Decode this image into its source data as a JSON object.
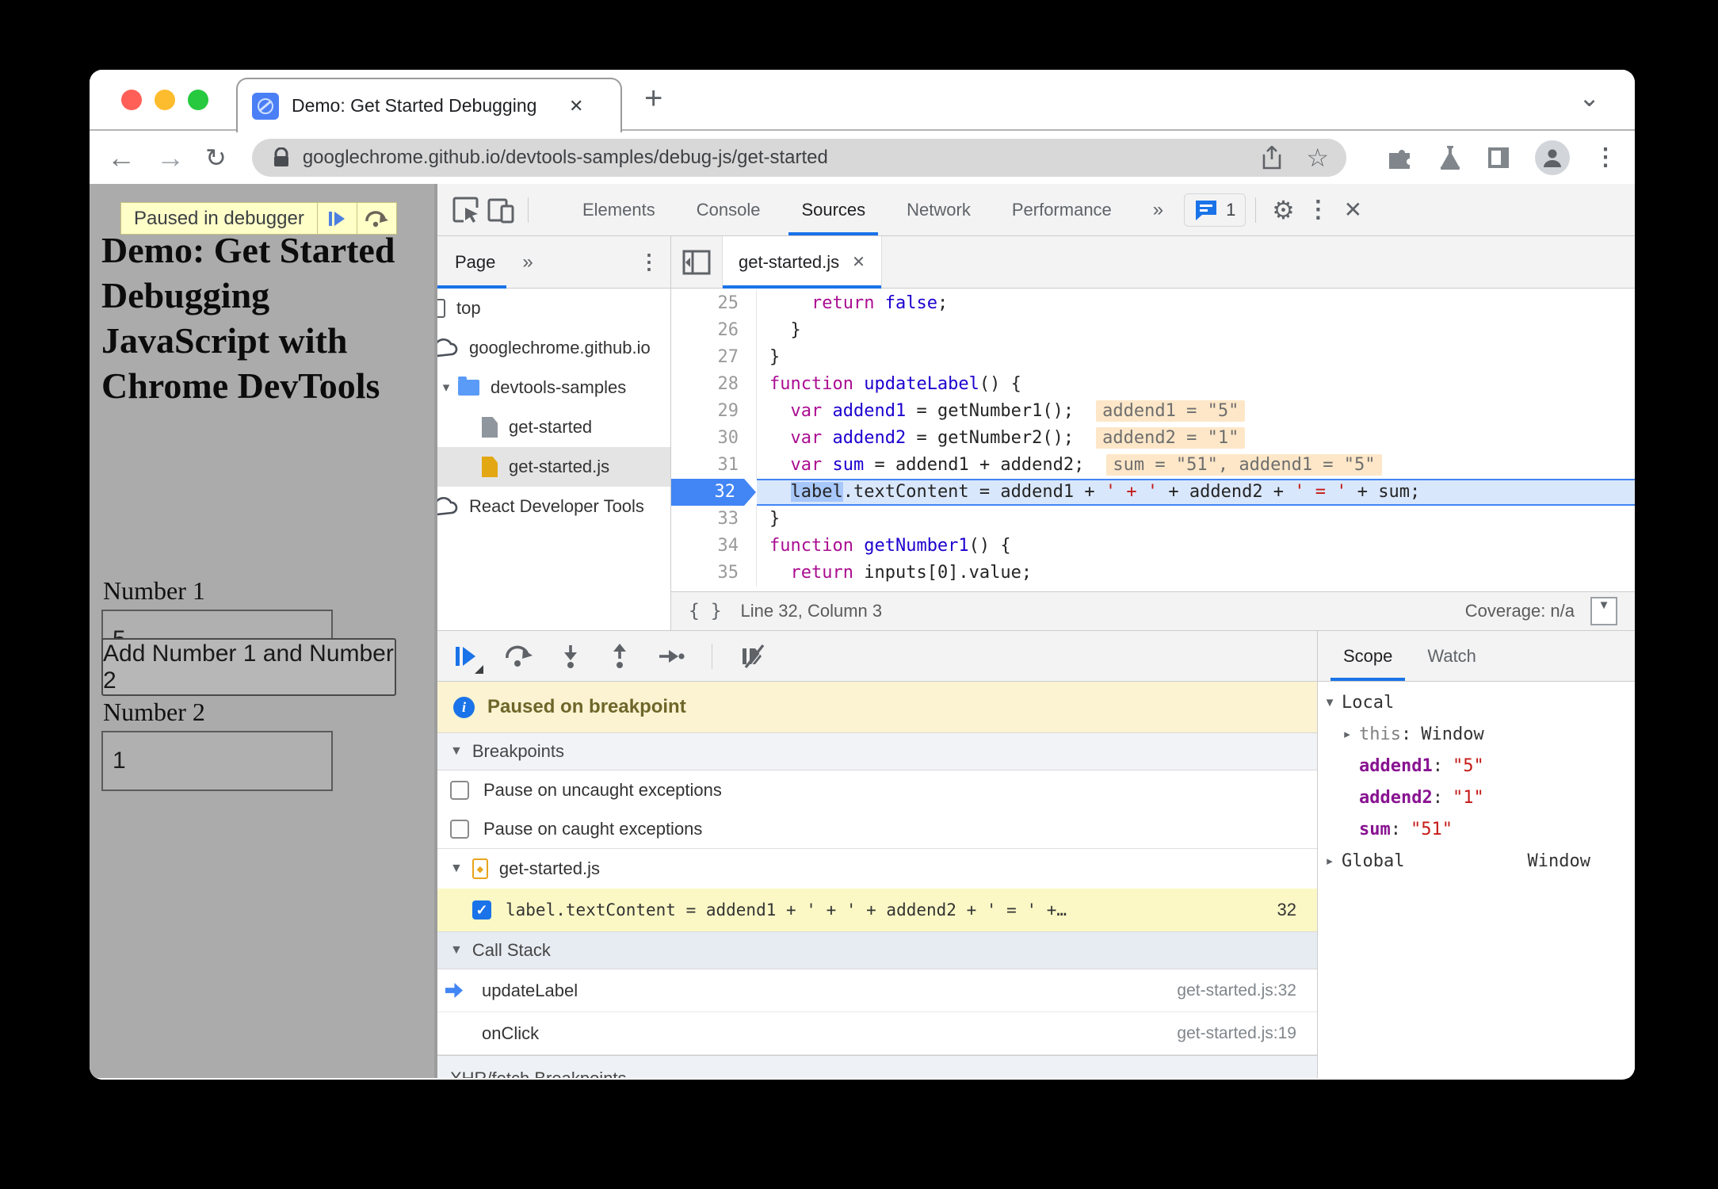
{
  "browser": {
    "tab_title": "Demo: Get Started Debugging",
    "tab_close": "✕",
    "new_tab": "+",
    "url": "googlechrome.github.io/devtools-samples/debug-js/get-started"
  },
  "page": {
    "paused_banner": "Paused in debugger",
    "heading_lines": [
      "Demo: Get Started",
      "Debugging",
      "JavaScript with",
      "Chrome DevTools"
    ],
    "field1_label": "Number 1",
    "field1_value": "5",
    "field2_label": "Number 2",
    "field2_value": "1",
    "add_button": "Add Number 1 and Number 2"
  },
  "devtools": {
    "toolbar": {
      "tabs": [
        {
          "label": "Elements",
          "active": false
        },
        {
          "label": "Console",
          "active": false
        },
        {
          "label": "Sources",
          "active": true
        },
        {
          "label": "Network",
          "active": false
        },
        {
          "label": "Performance",
          "active": false
        }
      ],
      "more": "»",
      "issues_count": "1",
      "settings": "⚙",
      "menu": "⋮",
      "close": "✕"
    },
    "navigator": {
      "tab_label": "Page",
      "more": "»",
      "menu": "⋮",
      "tree": [
        {
          "icon": "frame",
          "label": "top",
          "indent": 0,
          "arrow": "",
          "selected": false
        },
        {
          "icon": "cloud",
          "label": "googlechrome.github.io",
          "indent": 0,
          "arrow": "",
          "selected": false
        },
        {
          "icon": "folder",
          "label": "devtools-samples",
          "indent": 1,
          "arrow": "▾",
          "selected": false
        },
        {
          "icon": "file",
          "label": "get-started",
          "indent": 2,
          "arrow": "",
          "selected": false
        },
        {
          "icon": "file-js",
          "label": "get-started.js",
          "indent": 2,
          "arrow": "",
          "selected": true
        },
        {
          "icon": "cloud",
          "label": "React Developer Tools",
          "indent": 0,
          "arrow": "",
          "selected": false
        }
      ]
    },
    "editor": {
      "tab_label": "get-started.js",
      "tab_close": "✕",
      "lines": [
        {
          "n": "25",
          "tokens": [
            [
              "pl",
              "    "
            ],
            [
              "kw",
              "return"
            ],
            [
              "pl",
              " "
            ],
            [
              "atom",
              "false"
            ],
            [
              "pl",
              ";"
            ]
          ]
        },
        {
          "n": "26",
          "tokens": [
            [
              "pl",
              "  }"
            ]
          ]
        },
        {
          "n": "27",
          "tokens": [
            [
              "pl",
              "}"
            ]
          ]
        },
        {
          "n": "28",
          "tokens": [
            [
              "kw",
              "function"
            ],
            [
              "pl",
              " "
            ],
            [
              "def",
              "updateLabel"
            ],
            [
              "pl",
              "() {"
            ]
          ]
        },
        {
          "n": "29",
          "tokens": [
            [
              "pl",
              "  "
            ],
            [
              "kw",
              "var"
            ],
            [
              "pl",
              " "
            ],
            [
              "def",
              "addend1"
            ],
            [
              "pl",
              " = getNumber1();"
            ]
          ],
          "eval": "addend1 = \"5\""
        },
        {
          "n": "30",
          "tokens": [
            [
              "pl",
              "  "
            ],
            [
              "kw",
              "var"
            ],
            [
              "pl",
              " "
            ],
            [
              "def",
              "addend2"
            ],
            [
              "pl",
              " = getNumber2();"
            ]
          ],
          "eval": "addend2 = \"1\""
        },
        {
          "n": "31",
          "tokens": [
            [
              "pl",
              "  "
            ],
            [
              "kw",
              "var"
            ],
            [
              "pl",
              " "
            ],
            [
              "def",
              "sum"
            ],
            [
              "pl",
              " = addend1 + addend2;"
            ]
          ],
          "eval": "sum = \"51\", addend1 = \"5\""
        },
        {
          "n": "32",
          "paused": true,
          "tokens": [
            [
              "pl",
              "  "
            ],
            [
              "sel",
              "label"
            ],
            [
              "pl",
              ".textContent = addend1 + "
            ],
            [
              "str",
              "' + '"
            ],
            [
              "pl",
              " + addend2 + "
            ],
            [
              "str",
              "' = '"
            ],
            [
              "pl",
              " + sum;"
            ]
          ]
        },
        {
          "n": "33",
          "tokens": [
            [
              "pl",
              "}"
            ]
          ]
        },
        {
          "n": "34",
          "tokens": [
            [
              "kw",
              "function"
            ],
            [
              "pl",
              " "
            ],
            [
              "def",
              "getNumber1"
            ],
            [
              "pl",
              "() {"
            ]
          ]
        },
        {
          "n": "35",
          "tokens": [
            [
              "pl",
              "  "
            ],
            [
              "kw",
              "return"
            ],
            [
              "pl",
              " inputs[0].value;"
            ]
          ]
        }
      ],
      "status_position": "Line 32, Column 3",
      "coverage": "Coverage: n/a"
    },
    "debugger": {
      "paused_message": "Paused on breakpoint",
      "breakpoints_title": "Breakpoints",
      "checkboxes": [
        {
          "label": "Pause on uncaught exceptions",
          "checked": false
        },
        {
          "label": "Pause on caught exceptions",
          "checked": false
        }
      ],
      "file_group": "get-started.js",
      "breakpoint": {
        "checked": true,
        "code": "label.textContent = addend1 + ' + ' + addend2 + ' = ' +…",
        "line": "32"
      },
      "callstack_title": "Call Stack",
      "frames": [
        {
          "name": "updateLabel",
          "location": "get-started.js:32",
          "active": true
        },
        {
          "name": "onClick",
          "location": "get-started.js:19",
          "active": false
        }
      ],
      "partial_section": "XHR/fetch Breakpoints"
    },
    "scope": {
      "tabs": [
        "Scope",
        "Watch"
      ],
      "local_title": "Local",
      "entries": [
        {
          "arrow": "▸",
          "name": "this",
          "name_style": "gray",
          "value": "Window",
          "value_style": "dark"
        },
        {
          "arrow": "",
          "name": "addend1",
          "name_style": "purple",
          "value": "\"5\"",
          "value_style": "red"
        },
        {
          "arrow": "",
          "name": "addend2",
          "name_style": "purple",
          "value": "\"1\"",
          "value_style": "red"
        },
        {
          "arrow": "",
          "name": "sum",
          "name_style": "purple",
          "value": "\"51\"",
          "value_style": "red"
        }
      ],
      "global_title": "Global",
      "global_value": "Window"
    }
  },
  "colors": {
    "accent": "#1a73e8",
    "traffic_red": "#ff5f57",
    "traffic_yellow": "#fdbc2e",
    "traffic_green": "#27c93f"
  }
}
